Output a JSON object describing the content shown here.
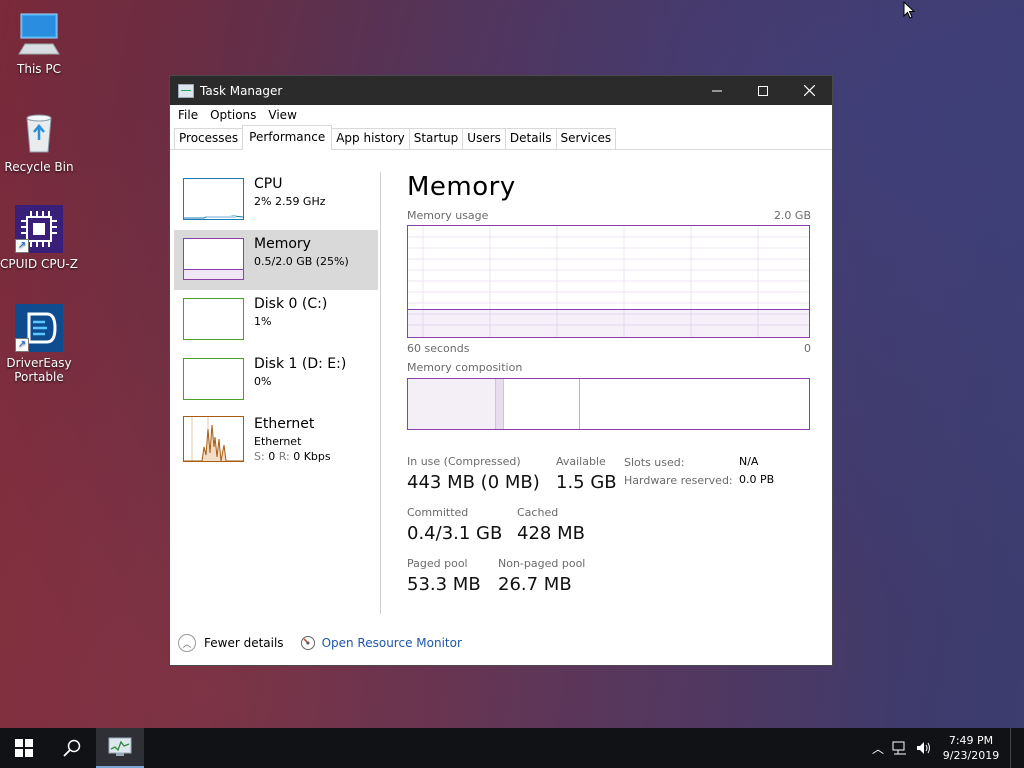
{
  "desktop": {
    "icons": [
      {
        "label": "This PC",
        "icon": "this-pc-icon"
      },
      {
        "label": "Recycle Bin",
        "icon": "recycle-bin-icon"
      },
      {
        "label": "CPUID CPU-Z",
        "icon": "cpu-z-icon"
      },
      {
        "label_line1": "DriverEasy",
        "label_line2": "Portable",
        "icon": "drivereasy-icon"
      }
    ]
  },
  "window": {
    "title": "Task Manager",
    "menu": [
      "File",
      "Options",
      "View"
    ],
    "tabs": [
      "Processes",
      "Performance",
      "App history",
      "Startup",
      "Users",
      "Details",
      "Services"
    ],
    "active_tab": "Performance"
  },
  "resources": [
    {
      "name": "CPU",
      "detail": "2%  2.59 GHz",
      "color": "#1a7ab8",
      "level_pct": 2
    },
    {
      "name": "Memory",
      "detail": "0.5/2.0 GB (25%)",
      "color": "#8b3fa8",
      "level_pct": 25,
      "selected": true
    },
    {
      "name": "Disk 0 (C:)",
      "detail": "1%",
      "color": "#4aa02c",
      "level_pct": 1
    },
    {
      "name": "Disk 1 (D: E:)",
      "detail": "0%",
      "color": "#4aa02c",
      "level_pct": 0
    },
    {
      "name": "Ethernet",
      "detail": "Ethernet",
      "s_label": "S:",
      "s_value": "0",
      "r_label": "R:",
      "r_value": "0 Kbps",
      "color": "#a75b12"
    }
  ],
  "memory": {
    "title": "Memory",
    "usage_label": "Memory usage",
    "usage_max": "2.0 GB",
    "time_left": "60 seconds",
    "time_right": "0",
    "usage_level_pct": 25,
    "composition_label": "Memory composition",
    "composition": {
      "in_use_pct": 22,
      "modified_pct": 2,
      "standby_pct": 19
    },
    "stats": {
      "in_use_label": "In use (Compressed)",
      "in_use_value": "443 MB (0 MB)",
      "available_label": "Available",
      "available_value": "1.5 GB",
      "committed_label": "Committed",
      "committed_value": "0.4/3.1 GB",
      "cached_label": "Cached",
      "cached_value": "428 MB",
      "paged_label": "Paged pool",
      "paged_value": "53.3 MB",
      "nonpaged_label": "Non-paged pool",
      "nonpaged_value": "26.7 MB",
      "slots_label": "Slots used:",
      "slots_value": "N/A",
      "hwres_label": "Hardware reserved:",
      "hwres_value": "0.0 PB"
    }
  },
  "footer": {
    "fewer_details": "Fewer details",
    "open_monitor": "Open Resource Monitor"
  },
  "taskbar": {
    "time": "7:49 PM",
    "date": "9/23/2019"
  }
}
